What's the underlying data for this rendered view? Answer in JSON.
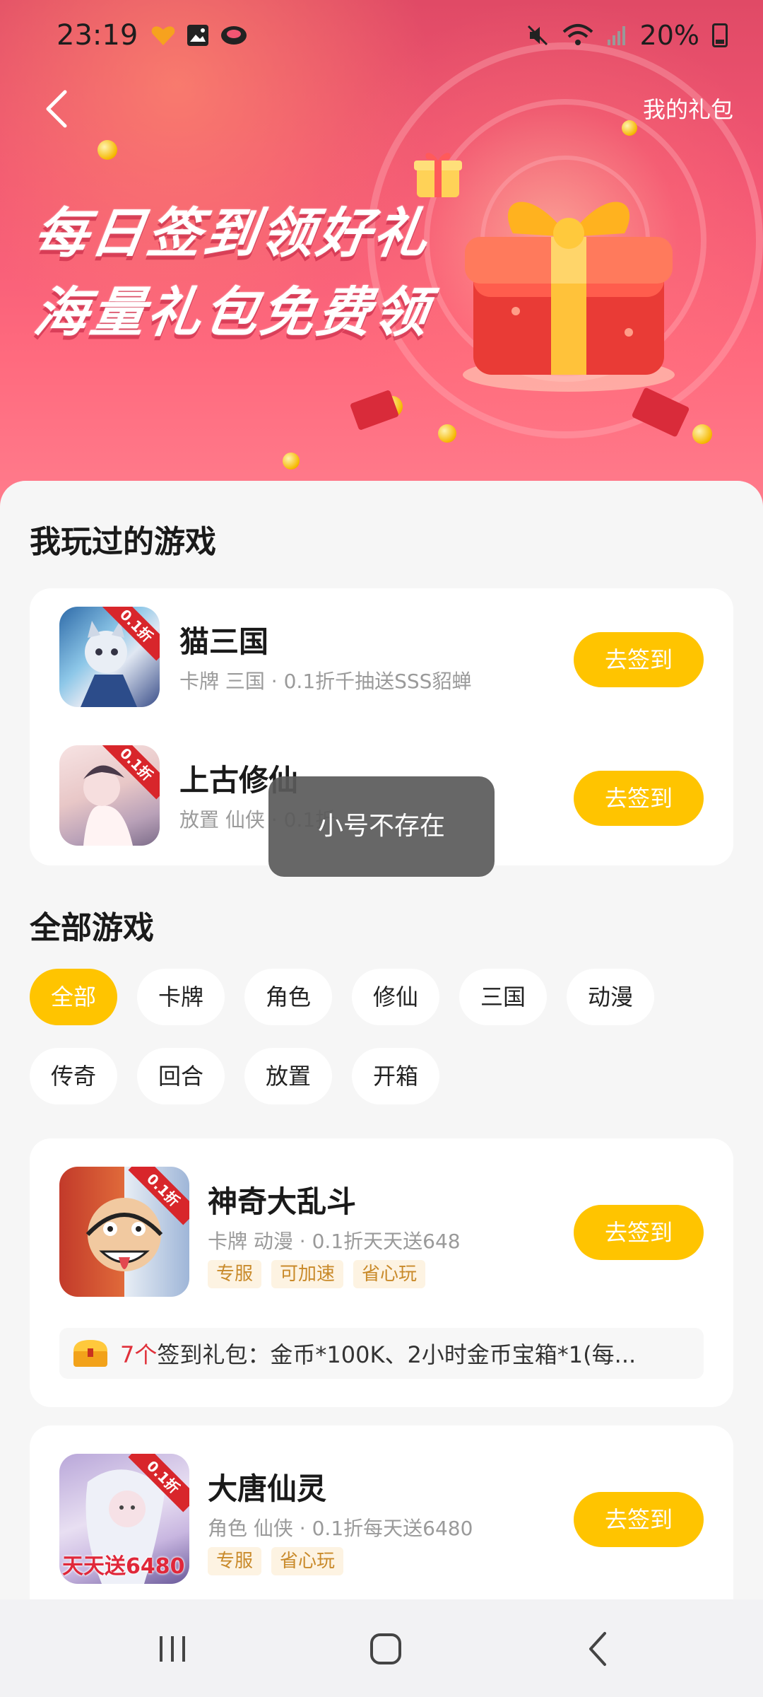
{
  "status_bar": {
    "time": "23:19",
    "battery": "20%"
  },
  "header": {
    "my_gift_label": "我的礼包"
  },
  "banner": {
    "line1": "每日签到领好礼",
    "line2": "海量礼包免费领"
  },
  "played_section": {
    "title": "我玩过的游戏",
    "games": [
      {
        "name": "猫三国",
        "subtitle": "卡牌 三国 · 0.1折千抽送SSS貂蝉",
        "ribbon": "0.1折",
        "button": "去签到"
      },
      {
        "name": "上古修仙",
        "subtitle": "放置 仙侠 · 0.1折",
        "ribbon": "0.1折",
        "button": "去签到"
      }
    ]
  },
  "all_section": {
    "title": "全部游戏",
    "chips": [
      "全部",
      "卡牌",
      "角色",
      "修仙",
      "三国",
      "动漫",
      "传奇",
      "回合",
      "放置",
      "开箱"
    ],
    "active_chip": "全部",
    "games": [
      {
        "name": "神奇大乱斗",
        "subtitle": "卡牌 动漫 · 0.1折天天送648",
        "ribbon": "0.1折",
        "tags": [
          "专服",
          "可加速",
          "省心玩"
        ],
        "button": "去签到",
        "gift_count": "7个",
        "gift_text": "签到礼包：金币*100K、2小时金币宝箱*1(每..."
      },
      {
        "name": "大唐仙灵",
        "subtitle": "角色 仙侠 · 0.1折每天送6480",
        "ribbon": "0.1折",
        "icon_text": "天天送6480",
        "tags": [
          "专服",
          "省心玩"
        ],
        "button": "去签到"
      }
    ]
  },
  "toast": {
    "message": "小号不存在"
  },
  "colors": {
    "accent": "#ffc400",
    "banner": "#f25673",
    "tag_text": "#c98a2a",
    "count_red": "#e0303a"
  },
  "icons": [
    "back-icon",
    "wifi-icon",
    "signal-icon",
    "battery-icon",
    "mute-icon",
    "recent-apps-icon",
    "home-icon",
    "nav-back-icon",
    "treasure-chest-icon"
  ]
}
